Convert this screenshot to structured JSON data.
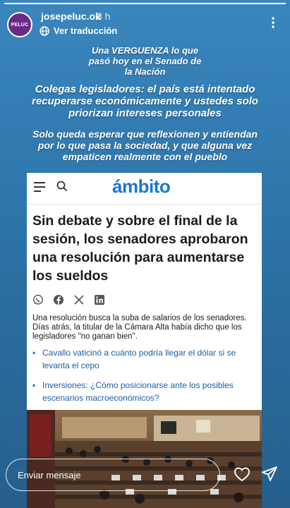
{
  "story": {
    "avatar_label": "PELUC",
    "username": "josepeluc.ok",
    "time": "3 h",
    "translate_label": "Ver traducción",
    "progress": 1.0,
    "caption_1": "Una VERGUENZA lo que\npasó hoy en el Senado de\nla Nación",
    "caption_2": "Colegas legisladores: el país está intentado\nrecuperarse económicamente y ustedes solo\npriorizan intereses personales",
    "caption_3": "Solo queda esperar que reflexionen y entiendan\npor lo que pasa la sociedad, y que alguna vez\nempaticen realmente con el pueblo"
  },
  "article": {
    "logo": "ámbito",
    "headline": "Sin debate y sobre el final de la sesión, los senadores aprobaron una resolución para aumentarse los sueldos",
    "summary": "Una resolución busca la suba de salarios de los senadores. Días atrás, la titular de la Cámara Alta había dicho que los legisladores \"no ganan bien\".",
    "related": [
      "Cavallo vaticinó a cuánto podría llegar el dólar si se levanta el cepo",
      "Inversiones: ¿Cómo posicionarse ante los posibles escenarios macroeconómicos?"
    ],
    "share_icons": [
      "whatsapp-icon",
      "facebook-icon",
      "x-icon",
      "linkedin-icon"
    ]
  },
  "composer": {
    "placeholder": "Enviar mensaje"
  },
  "colors": {
    "background": "#2f78ae",
    "logo_blue": "#1a77d2",
    "link_blue": "#1a5ea8"
  }
}
